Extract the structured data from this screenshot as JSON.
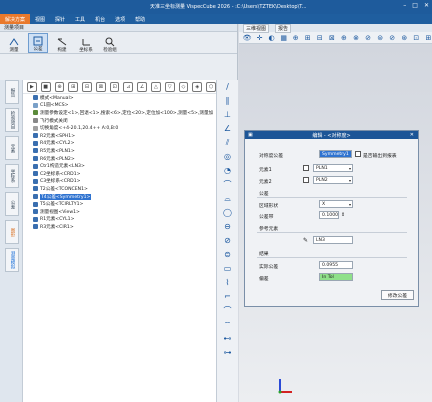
{
  "window": {
    "title": "天准三坐标测量 VispecCube 2026 - :C:\\Users\\TZTEK\\Desktop\\T..."
  },
  "menu": [
    {
      "label": "解决方案",
      "active": true
    },
    {
      "label": "视图"
    },
    {
      "label": "探针"
    },
    {
      "label": "工具"
    },
    {
      "label": "机台"
    },
    {
      "label": "选项"
    },
    {
      "label": "帮助"
    }
  ],
  "left_panel": {
    "title": "测量项目",
    "toolbar": [
      {
        "label": "测量",
        "icon": "measure-icon"
      },
      {
        "label": "公差",
        "icon": "tolerance-icon",
        "selected": true
      },
      {
        "label": "构建",
        "icon": "construct-icon"
      },
      {
        "label": "坐标系",
        "icon": "coordinate-icon"
      },
      {
        "label": "检验组",
        "icon": "inspection-group-icon"
      }
    ],
    "side_tabs": [
      {
        "label": "报告",
        "color": "normal"
      },
      {
        "label": "检验项目",
        "color": "normal"
      },
      {
        "label": "元素",
        "color": "normal"
      },
      {
        "label": "坐标系",
        "color": "normal"
      },
      {
        "label": "公差",
        "color": "normal"
      },
      {
        "label": "图形",
        "color": "orange"
      },
      {
        "label": "测量模拟",
        "color": "blue"
      }
    ],
    "tree_toolbar": [
      "▶",
      "■",
      "⊕",
      "⊞",
      "⊟",
      "⊠",
      "⊡",
      "⊿",
      "∠",
      "△",
      "▽",
      "◇",
      "◈",
      "⬡"
    ],
    "tree_rows": [
      {
        "label": "模式<Manual>",
        "color": "#3a6fb0"
      },
      {
        "label": "C1圆<MCS>",
        "color": "#7aa0c8"
      },
      {
        "label": "测量参数设定<1>,回退<1>,搜索<6>,定位<20>,定位加<100>,测量<5>,测量加",
        "color": "#5b8b3a"
      },
      {
        "label": "飞行模式关闭",
        "color": "#888"
      },
      {
        "label": "切换角度<+4-20.1,20.4++ A:0,B:0",
        "color": "#a0a0a0"
      },
      {
        "label": "R2元素<SPH1>",
        "color": "#3a6fb0"
      },
      {
        "label": "R4元素<CYL2>",
        "color": "#3a6fb0"
      },
      {
        "label": "R5元素<PLN1>",
        "color": "#3a6fb0"
      },
      {
        "label": "R6元素<PLN2>",
        "color": "#3a6fb0"
      },
      {
        "label": "Ctr1构造元素<LN3>",
        "color": "#3a6fb0"
      },
      {
        "label": "C2坐标系<CRD1>",
        "color": "#3a6fb0"
      },
      {
        "label": "C3坐标系<CRD1>",
        "color": "#3a6fb0"
      },
      {
        "label": "T2公差<TCONCEN1>",
        "color": "#3a6fb0"
      },
      {
        "label": "T4公差<Symmetry1>",
        "color": "#3a6fb0",
        "selected": true
      },
      {
        "label": "T5公差<TCIRLTY1>",
        "color": "#3a6fb0"
      },
      {
        "label": "测量视图<View1>",
        "color": "#3a6fb0"
      },
      {
        "label": "R1元素<CYL1>",
        "color": "#3a6fb0"
      },
      {
        "label": "R3元素<CIR1>",
        "color": "#3a6fb0"
      }
    ],
    "vertical_tools": [
      "∕",
      "∥",
      "⊥",
      "∠",
      "⫽",
      "◎",
      "◔",
      "⌒",
      "⌓",
      "◯",
      "⊖",
      "⊘",
      "⊜",
      "▭",
      "⌇",
      "⌐",
      "⌒",
      "⌔",
      "⊷",
      "⊶"
    ]
  },
  "right_area": {
    "tabs": [
      "三维视图",
      "报告"
    ],
    "tools": [
      "👁",
      "✛",
      "◐",
      "▦",
      "⊕",
      "⊞",
      "⊟",
      "⊠",
      "⊕",
      "⊗",
      "⊘",
      "⊜",
      "⊘",
      "⊛",
      "⊡",
      "⊞"
    ]
  },
  "dialog": {
    "title": "编辑 - <对称度> ",
    "fields": {
      "symmetry_label": "对称度公差",
      "symmetry_value": "Symmetry1",
      "output_checkbox_label": "是否输出到报表",
      "element1_label": "元素1",
      "element1_value": "PLN1",
      "element2_label": "元素2",
      "element2_value": "PLN2",
      "tolerance_section": "公差",
      "zone_shape_label": "区域形状",
      "zone_shape_value": "X",
      "tolerance_band_label": "公差带",
      "tolerance_band_value": "0.1000",
      "reference_section": "参考元素",
      "reference_value": "LN3",
      "result_section": "结果",
      "actual_label": "实际公差",
      "actual_value": "0.0955",
      "deviation_label": "偏差",
      "deviation_value": "In Tol",
      "modify_button": "修改公差"
    }
  }
}
